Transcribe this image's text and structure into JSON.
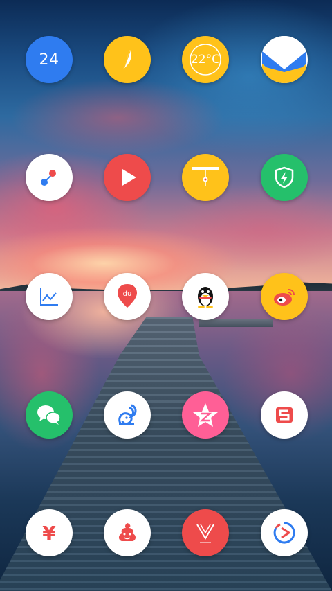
{
  "colors": {
    "blue": "#2f7cf0",
    "yellow": "#ffc21a",
    "red": "#ee4b4b",
    "green": "#25c06b",
    "pink": "#ff5f96",
    "white": "#ffffff"
  },
  "home_screen": {
    "rows": [
      [
        {
          "name": "calendar",
          "icon": "calendar-icon",
          "label": "24"
        },
        {
          "name": "notes",
          "icon": "feather-icon"
        },
        {
          "name": "weather",
          "icon": "weather-icon",
          "label": "22°C"
        },
        {
          "name": "mail",
          "icon": "envelope-icon"
        }
      ],
      [
        {
          "name": "app-dots",
          "icon": "dots-icon"
        },
        {
          "name": "video-player",
          "icon": "play-icon"
        },
        {
          "name": "flashlight",
          "icon": "flashlight-icon"
        },
        {
          "name": "security",
          "icon": "shield-bolt-icon"
        }
      ],
      [
        {
          "name": "stocks",
          "icon": "chart-line-icon"
        },
        {
          "name": "baidu-maps",
          "icon": "map-pin-du-icon",
          "label": "du"
        },
        {
          "name": "qq",
          "icon": "penguin-icon"
        },
        {
          "name": "weibo",
          "icon": "weibo-icon"
        }
      ],
      [
        {
          "name": "wechat",
          "icon": "chat-bubbles-icon"
        },
        {
          "name": "uc-browser",
          "icon": "squirrel-icon"
        },
        {
          "name": "qzone",
          "icon": "star-z-icon"
        },
        {
          "name": "sohu",
          "icon": "s-logo-icon"
        }
      ],
      [
        {
          "name": "finance",
          "icon": "yen-icon",
          "label": "¥"
        },
        {
          "name": "poop-app",
          "icon": "poop-icon"
        },
        {
          "name": "vipshop",
          "icon": "v-logo-icon"
        },
        {
          "name": "video-app",
          "icon": "circle-play-icon"
        }
      ]
    ]
  }
}
